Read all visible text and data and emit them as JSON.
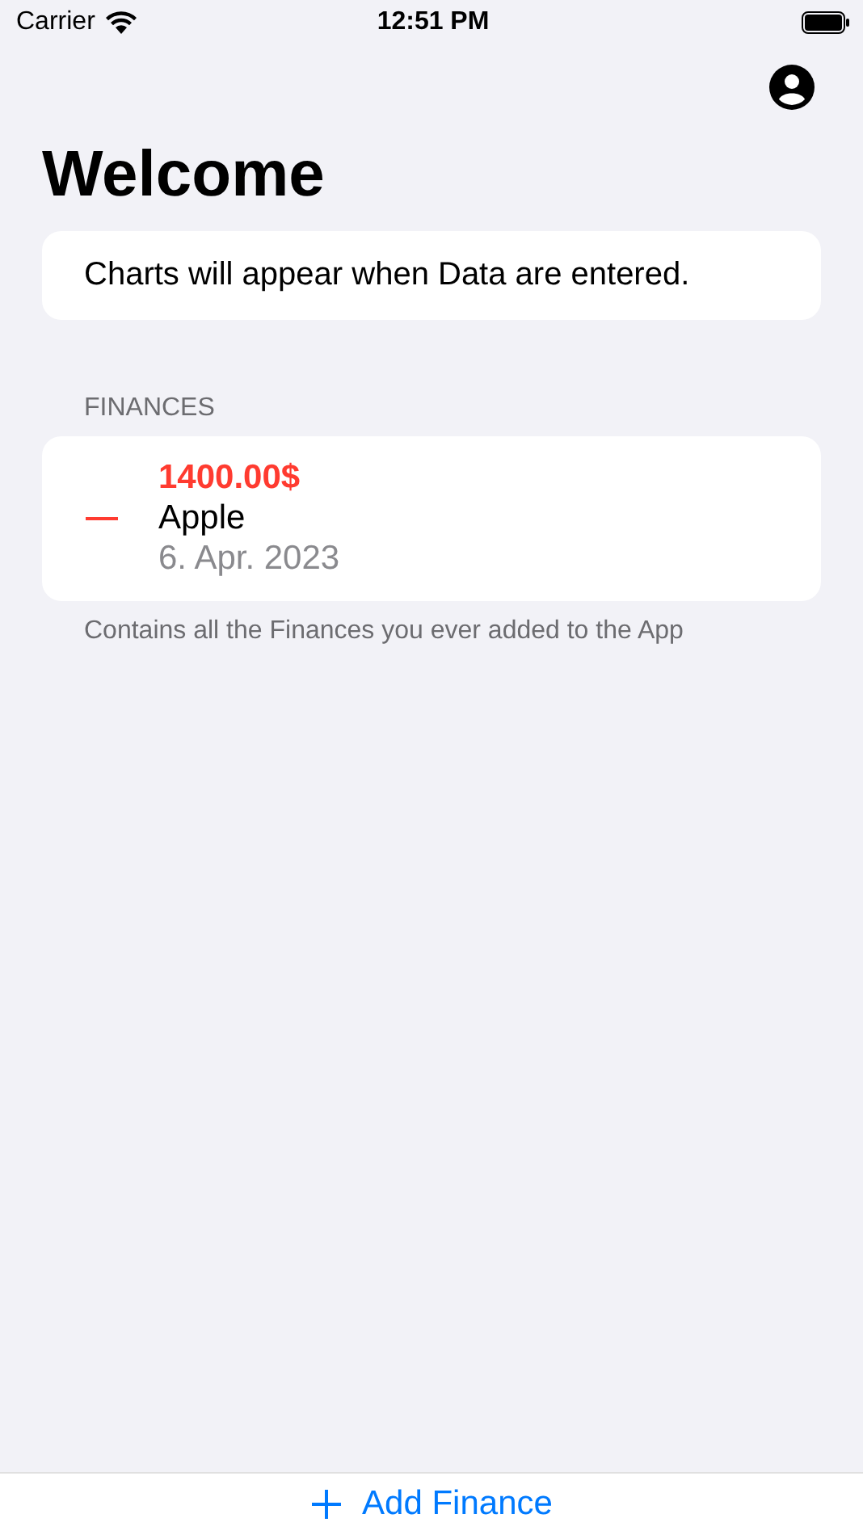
{
  "status_bar": {
    "carrier": "Carrier",
    "time": "12:51 PM"
  },
  "title": "Welcome",
  "chart_notice": "Charts will appear when Data are entered.",
  "finances": {
    "header": "FINANCES",
    "footer": "Contains all the Finances you ever added to the App",
    "items": [
      {
        "kind": "expense",
        "amount": "1400.00$",
        "name": "Apple",
        "date": "6. Apr. 2023"
      }
    ]
  },
  "add_button": {
    "label": "Add Finance"
  }
}
